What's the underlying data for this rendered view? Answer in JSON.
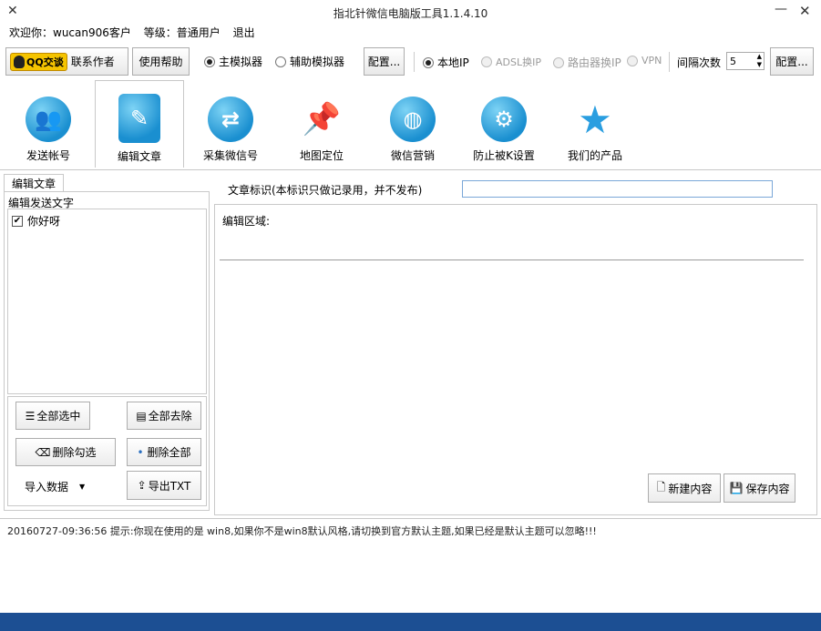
{
  "window": {
    "title": "指北针微信电脑版工具1.1.4.10"
  },
  "info": {
    "welcome": "欢迎你：wucan906客户",
    "level": "等级：普通用户",
    "logout": "退出"
  },
  "toolbar": {
    "qq_label": "QQ交谈",
    "contact_label": "联系作者",
    "help_label": "使用帮助",
    "main_sim_label": "主模拟器",
    "aux_sim_label": "辅助模拟器",
    "config1_label": "配置...",
    "local_ip_label": "本地IP",
    "adsl_label": "ADSL换IP",
    "router_label": "路由器换IP",
    "vpn_label": "VPN",
    "interval_label": "间隔次数",
    "interval_value": "5",
    "config2_label": "配置..."
  },
  "nav": {
    "tabs": [
      {
        "label": "发送帐号",
        "icon": "users-icon"
      },
      {
        "label": "编辑文章",
        "icon": "edit-icon"
      },
      {
        "label": "采集微信号",
        "icon": "shuffle-icon"
      },
      {
        "label": "地图定位",
        "icon": "pin-icon"
      },
      {
        "label": "微信营销",
        "icon": "globe-icon"
      },
      {
        "label": "防止被K设置",
        "icon": "gears-icon"
      },
      {
        "label": "我们的产品",
        "icon": "star-icon"
      }
    ]
  },
  "left": {
    "tab_label": "编辑文章",
    "group_label": "编辑发送文字",
    "items": [
      {
        "label": "你好呀",
        "checked": true
      }
    ],
    "select_all": "全部选中",
    "remove_all": "全部去除",
    "delete_checked": "删除勾选",
    "delete_all": "删除全部",
    "import_label": "导入数据",
    "export_label": "导出TXT"
  },
  "right": {
    "tag_label": "文章标识(本标识只做记录用，并不发布)",
    "tag_value": "",
    "edit_label": "编辑区域:",
    "new_label": "新建内容",
    "save_label": "保存内容"
  },
  "status": {
    "text": "20160727-09:36:56  提示:你现在使用的是 win8,如果你不是win8默认风格,请切换到官方默认主题,如果已经是默认主题可以忽略!!!"
  }
}
